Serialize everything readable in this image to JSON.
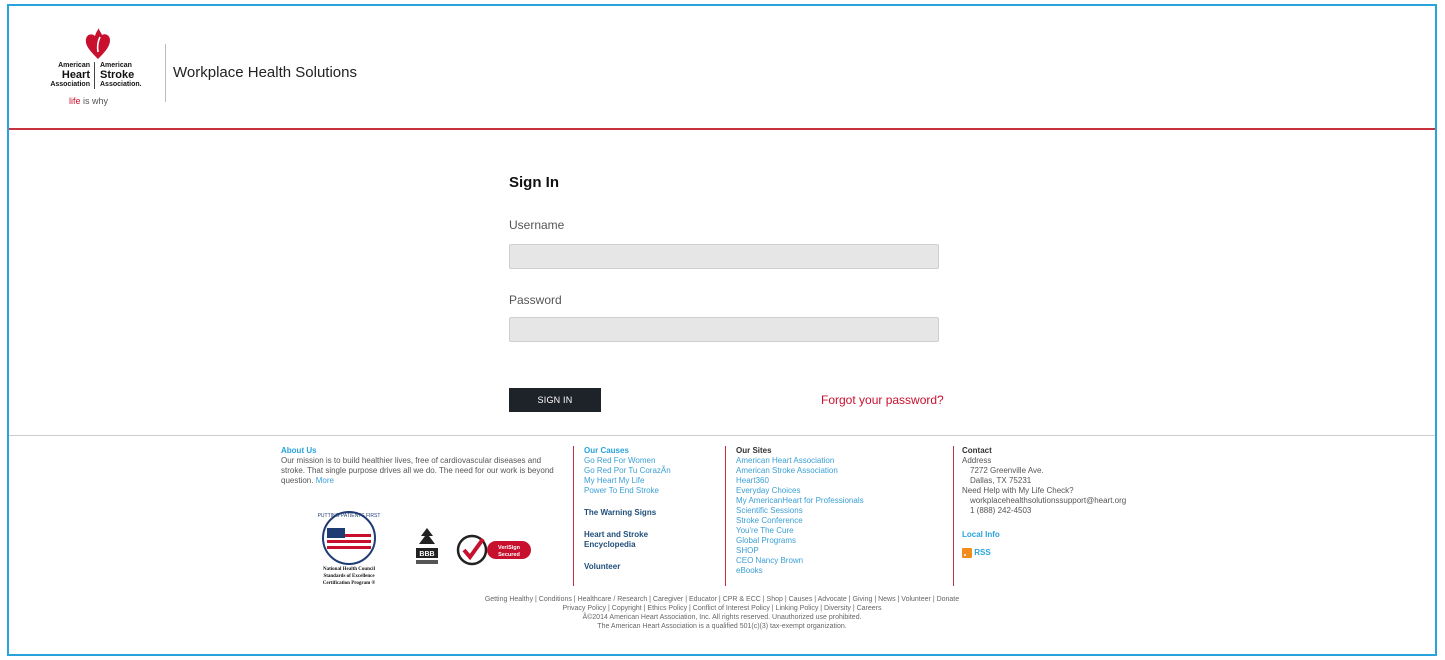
{
  "header": {
    "logo": {
      "left_line1": "American",
      "left_line2": "Heart",
      "left_line3": "Association",
      "right_line1": "American",
      "right_line2": "Stroke",
      "right_line3": "Association.",
      "tagline_red": "life",
      "tagline_rest": " is why"
    },
    "title": "Workplace Health Solutions"
  },
  "signin": {
    "heading": "Sign In",
    "username_label": "Username",
    "username_value": "",
    "password_label": "Password",
    "password_value": "",
    "button_label": "SIGN IN",
    "forgot_link": "Forgot your password?"
  },
  "footer": {
    "about": {
      "heading": "About Us",
      "text": "Our mission is to build healthier lives, free of cardiovascular diseases and stroke. That single purpose drives all we do. The need for our work is beyond question.",
      "more": "More"
    },
    "causes": {
      "heading": "Our Causes",
      "links": [
        "Go Red For Women",
        "Go Red Por Tu CorazÃn",
        "My Heart My Life",
        "Power To End Stroke"
      ],
      "bold_links": [
        "The Warning Signs",
        "Heart and Stroke Encyclopedia",
        "Volunteer"
      ]
    },
    "sites": {
      "heading": "Our Sites",
      "links": [
        "American Heart Association",
        "American Stroke Association",
        "Heart360",
        "Everyday Choices",
        "My AmericanHeart for Professionals",
        "Scientific Sessions",
        "Stroke Conference",
        "You're The Cure",
        "Global Programs",
        "SHOP",
        "CEO Nancy Brown",
        "eBooks"
      ]
    },
    "contact": {
      "heading": "Contact",
      "address_label": "Address",
      "street": "7272 Greenville Ave.",
      "city": "Dallas, TX 75231",
      "help": "Need Help with My Life Check?",
      "email": "workplacehealthsolutionssupport@heart.org",
      "phone": "1 (888) 242-4503",
      "local_info": "Local Info",
      "rss": "RSS"
    },
    "badges": {
      "npf_top": "PUTTING PATIENTS FIRST",
      "npf_line1": "National Health Council",
      "npf_line2": "Standards of Excellence",
      "npf_line3": "Certification Program ®",
      "bbb": "BBB",
      "verisign_line1": "VeriSign",
      "verisign_line2": "Secured"
    },
    "legal": {
      "line1": "Getting Healthy | Conditions | Healthcare / Research | Caregiver | Educator | CPR & ECC | Shop | Causes | Advocate | Giving | News | Volunteer | Donate",
      "line2": "Privacy Policy | Copyright | Ethics Policy | Conflict of Interest Policy | Linking Policy | Diversity | Careers",
      "line3": "Â©2014 American Heart Association, Inc. All rights reserved. Unauthorized use prohibited.",
      "line4": "The American Heart Association is a qualified 501(c)(3) tax-exempt organization."
    }
  },
  "colors": {
    "accent_red": "#c8102e",
    "frame_blue": "#29a3dc",
    "link_blue": "#3b9fd6",
    "button_dark": "#1e2229"
  }
}
